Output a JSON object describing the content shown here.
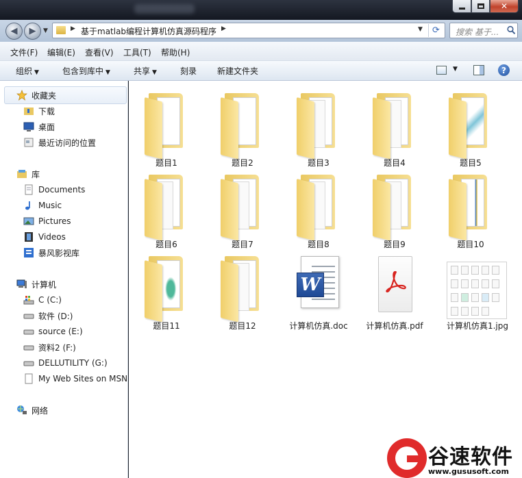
{
  "window": {
    "title_controls": {
      "minimize": "",
      "maximize": "",
      "close": "✕"
    }
  },
  "address": {
    "path": "基于matlab编程计算机仿真源码程序",
    "search_placeholder": "搜索 基于..."
  },
  "menu": [
    "文件(F)",
    "编辑(E)",
    "查看(V)",
    "工具(T)",
    "帮助(H)"
  ],
  "commands": {
    "organize": "组织",
    "include_in_library": "包含到库中",
    "share": "共享",
    "burn": "刻录",
    "new_folder": "新建文件夹"
  },
  "nav": {
    "favorites": {
      "label": "收藏夹",
      "items": [
        "下载",
        "桌面",
        "最近访问的位置"
      ]
    },
    "libraries": {
      "label": "库",
      "items": [
        "Documents",
        "Music",
        "Pictures",
        "Videos",
        "暴风影视库"
      ]
    },
    "computer": {
      "label": "计算机",
      "items": [
        "C (C:)",
        "软件 (D:)",
        "source (E:)",
        "资料2 (F:)",
        "DELLUTILITY (G:)",
        "My Web Sites on MSN"
      ]
    },
    "network": {
      "label": "网络"
    }
  },
  "files": [
    {
      "name": "题目1",
      "type": "folder"
    },
    {
      "name": "题目2",
      "type": "folder"
    },
    {
      "name": "题目3",
      "type": "folder"
    },
    {
      "name": "题目4",
      "type": "folder"
    },
    {
      "name": "题目5",
      "type": "folder"
    },
    {
      "name": "题目6",
      "type": "folder"
    },
    {
      "name": "题目7",
      "type": "folder"
    },
    {
      "name": "题目8",
      "type": "folder"
    },
    {
      "name": "题目9",
      "type": "folder"
    },
    {
      "name": "题目10",
      "type": "folder"
    },
    {
      "name": "题目11",
      "type": "folder"
    },
    {
      "name": "题目12",
      "type": "folder"
    },
    {
      "name": "计算机仿真.doc",
      "type": "doc"
    },
    {
      "name": "计算机仿真.pdf",
      "type": "pdf"
    },
    {
      "name": "计算机仿真1.jpg",
      "type": "jpg"
    }
  ],
  "watermark": {
    "brand": "谷速软件",
    "url": "www.gususoft.com"
  },
  "colors": {
    "folder": "#f2d479",
    "accent": "#1f4a96",
    "pdf_red": "#d8231e",
    "watermark_red": "#e02b2b"
  }
}
